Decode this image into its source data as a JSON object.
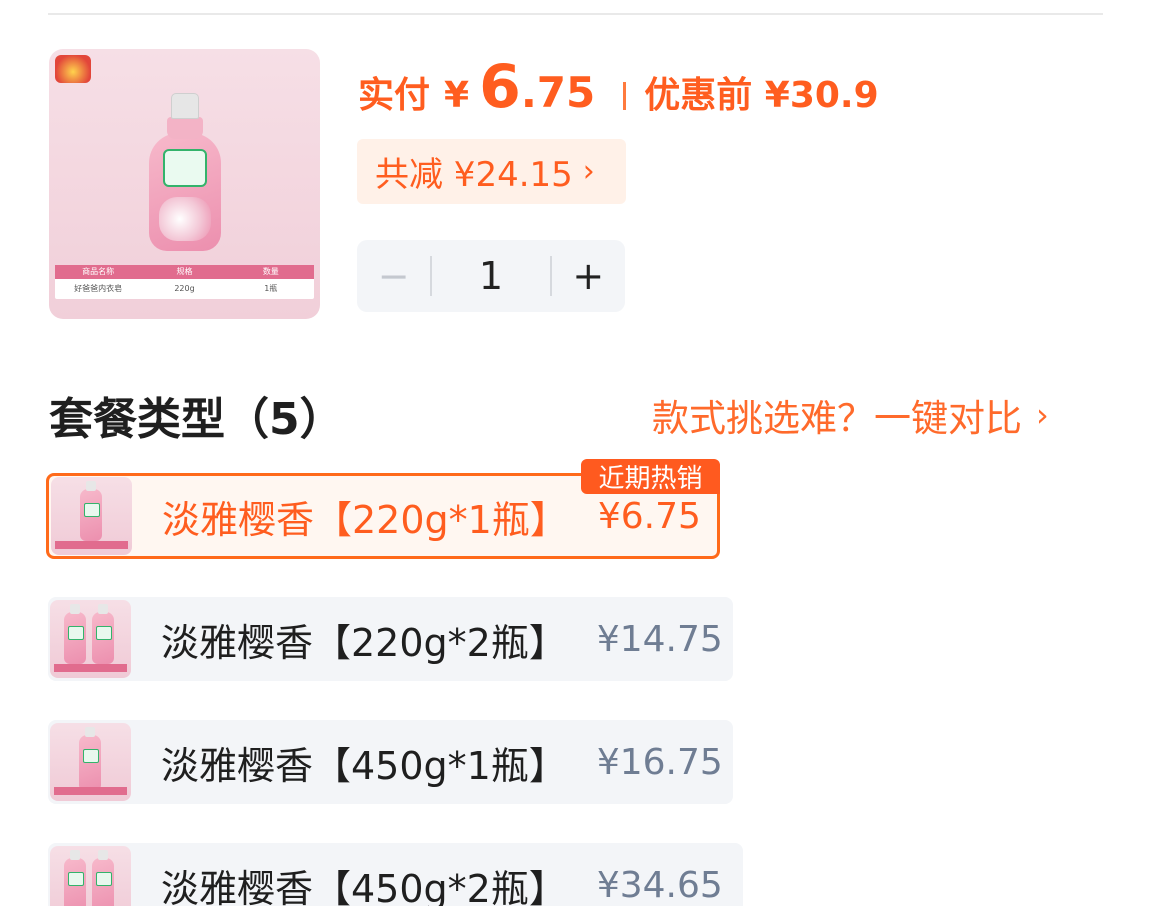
{
  "product": {
    "image_table": {
      "headers": [
        "商品名称",
        "规格",
        "数量"
      ],
      "row": [
        "好爸爸内衣皂",
        "220g",
        "1瓶"
      ]
    }
  },
  "price": {
    "paid_label": "实付",
    "currency": "¥",
    "amount_int": "6",
    "amount_dec": ".75",
    "original_label": "优惠前 ¥30.9",
    "discount_text": "共减 ¥24.15",
    "discount_arrow": "›"
  },
  "quantity": {
    "minus": "−",
    "value": "1",
    "plus": "+"
  },
  "packages": {
    "title": "套餐类型（5）",
    "compare_text": "款式挑选难？一键对比",
    "compare_arrow": "›",
    "hot_badge": "近期热销",
    "items": [
      {
        "name": "淡雅樱香【220g*1瓶】",
        "price": "¥6.75",
        "selected": true
      },
      {
        "name": "淡雅樱香【220g*2瓶】",
        "price": "¥14.75",
        "selected": false
      },
      {
        "name": "淡雅樱香【450g*1瓶】",
        "price": "¥16.75",
        "selected": false
      },
      {
        "name": "淡雅樱香【450g*2瓶】",
        "price": "¥34.65",
        "selected": false
      }
    ]
  },
  "colors": {
    "accent": "#ff5d1f",
    "chip_bg": "#fff1e8",
    "option_bg": "#f3f5f8",
    "muted_price": "#6f7d93"
  }
}
